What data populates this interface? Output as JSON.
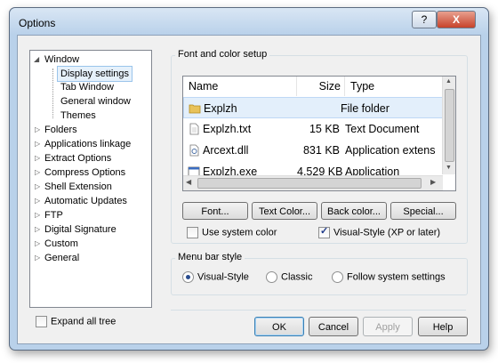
{
  "window": {
    "title": "Options",
    "help_label": "?",
    "close_label": "X"
  },
  "tree": {
    "items": [
      {
        "label": "Window",
        "state": "expanded"
      },
      {
        "label": "Display settings",
        "selected": true
      },
      {
        "label": "Tab Window"
      },
      {
        "label": "General window"
      },
      {
        "label": "Themes"
      },
      {
        "label": "Folders"
      },
      {
        "label": "Applications linkage"
      },
      {
        "label": "Extract Options"
      },
      {
        "label": "Compress Options"
      },
      {
        "label": "Shell Extension"
      },
      {
        "label": "Automatic Updates"
      },
      {
        "label": "FTP"
      },
      {
        "label": "Digital Signature"
      },
      {
        "label": "Custom"
      },
      {
        "label": "General"
      }
    ],
    "expand_all_label": "Expand all tree"
  },
  "font_color": {
    "group_label": "Font and color setup",
    "columns": [
      "Name",
      "Size",
      "Type"
    ],
    "rows": [
      {
        "name": "Explzh",
        "size": "",
        "type": "File folder",
        "icon": "folder-icon"
      },
      {
        "name": "Explzh.txt",
        "size": "15 KB",
        "type": "Text Document",
        "icon": "text-file-icon"
      },
      {
        "name": "Arcext.dll",
        "size": "831 KB",
        "type": "Application extens",
        "icon": "dll-file-icon"
      },
      {
        "name": "Explzh.exe",
        "size": "4,529 KB",
        "type": "Application",
        "icon": "exe-file-icon"
      }
    ],
    "buttons": {
      "font": "Font...",
      "text_color": "Text Color...",
      "back_color": "Back color...",
      "special": "Special..."
    },
    "use_system_color": {
      "label": "Use system color",
      "checked": false
    },
    "visual_style": {
      "label": "Visual-Style (XP or later)",
      "checked": true
    }
  },
  "menu_bar": {
    "group_label": "Menu bar style",
    "options": [
      {
        "label": "Visual-Style",
        "selected": true
      },
      {
        "label": "Classic",
        "selected": false
      },
      {
        "label": "Follow system settings",
        "selected": false
      }
    ]
  },
  "footer": {
    "ok": "OK",
    "cancel": "Cancel",
    "apply": "Apply",
    "help": "Help"
  }
}
